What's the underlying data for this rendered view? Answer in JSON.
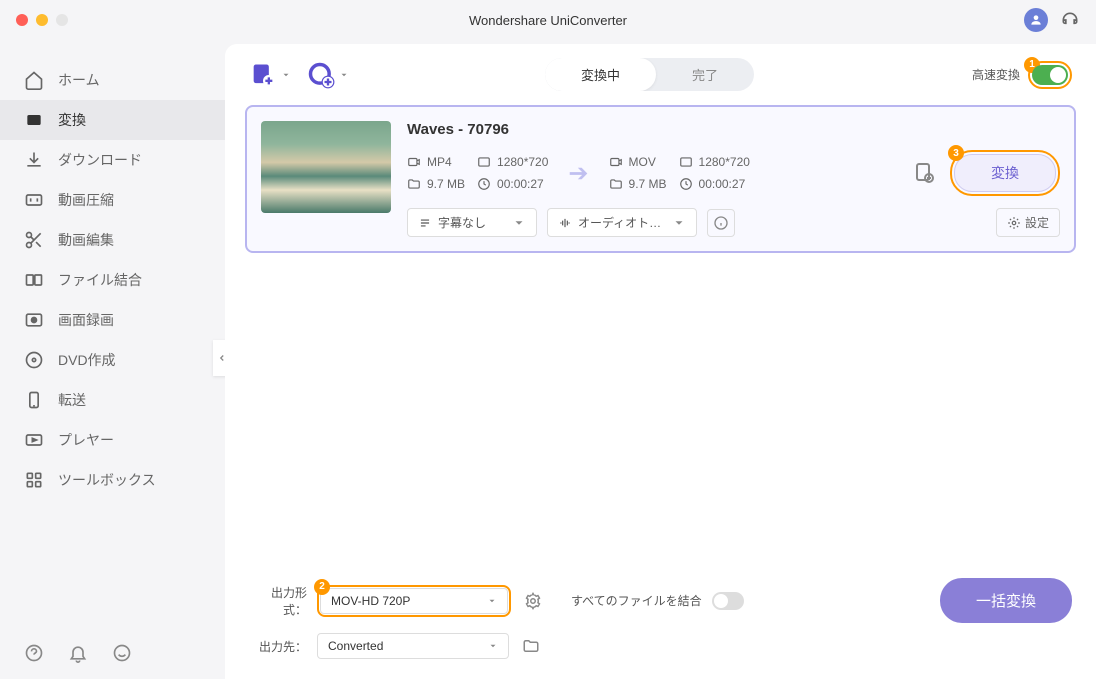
{
  "app": {
    "title": "Wondershare UniConverter"
  },
  "sidebar": {
    "items": [
      {
        "label": "ホーム"
      },
      {
        "label": "変換"
      },
      {
        "label": "ダウンロード"
      },
      {
        "label": "動画圧縮"
      },
      {
        "label": "動画編集"
      },
      {
        "label": "ファイル結合"
      },
      {
        "label": "画面録画"
      },
      {
        "label": "DVD作成"
      },
      {
        "label": "転送"
      },
      {
        "label": "プレヤー"
      },
      {
        "label": "ツールボックス"
      }
    ]
  },
  "tabs": {
    "converting": "変換中",
    "done": "完了"
  },
  "toolbar": {
    "high_speed": "高速変換"
  },
  "badges": {
    "b1": "1",
    "b2": "2",
    "b3": "3"
  },
  "file": {
    "title": "Waves - 70796",
    "src": {
      "format": "MP4",
      "res": "1280*720",
      "size": "9.7 MB",
      "dur": "00:00:27"
    },
    "dst": {
      "format": "MOV",
      "res": "1280*720",
      "size": "9.7 MB",
      "dur": "00:00:27"
    },
    "subtitle": "字幕なし",
    "audio": "オーディオトラッ…",
    "settings": "設定",
    "convert": "変換"
  },
  "bottom": {
    "output_format_label": "出力形式：",
    "output_format_value": "MOV-HD 720P",
    "output_dir_label": "出力先：",
    "output_dir_value": "Converted",
    "merge_label": "すべてのファイルを結合",
    "batch": "一括変換"
  }
}
